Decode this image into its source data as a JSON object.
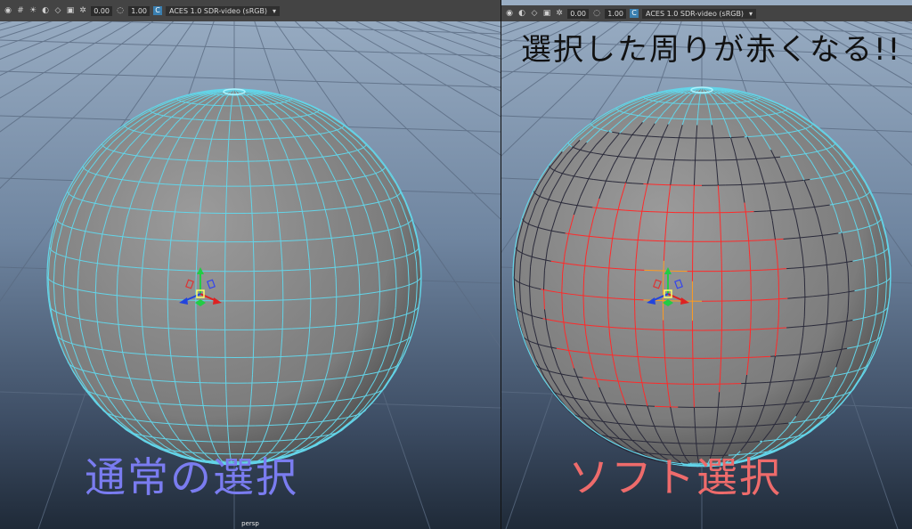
{
  "left_view": {
    "toolbar": {
      "value_a": "0.00",
      "value_b": "1.00",
      "ocio": "ACES 1.0 SDR-video (sRGB)"
    },
    "caption": "通常の選択",
    "camera_label": "persp"
  },
  "right_view": {
    "toolbar": {
      "value_a": "0.00",
      "value_b": "1.00",
      "ocio": "ACES 1.0 SDR-video (sRGB)"
    },
    "caption": "ソフト選択",
    "note": "選択した周りが赤くなる!!"
  },
  "colors": {
    "wire": "#63d4e8",
    "soft_hot": "#ff2a2a",
    "soft_warm": "#ff9a20",
    "soft_cold": "#2a2a3a",
    "sphere": "#8a8a8a"
  },
  "icons": [
    "camera-icon",
    "grid-icon",
    "light-icon",
    "shading-icon",
    "isolate-icon",
    "colorspace-icon"
  ]
}
